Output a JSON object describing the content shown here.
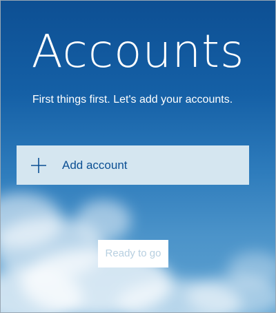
{
  "header": {
    "title": "Accounts",
    "subtitle": "First things first. Let's add your accounts."
  },
  "actions": {
    "add_account_label": "Add account",
    "ready_label": "Ready to go",
    "ready_state": "disabled"
  },
  "icons": {
    "add": "plus-icon"
  },
  "colors": {
    "sky_top": "#0d4f93",
    "sky_bottom": "#5fa3d2",
    "add_button_bg": "#d5e6f0",
    "add_button_text": "#0b4f93",
    "ready_button_bg": "#ffffff",
    "ready_button_text": "#b7cfe0"
  }
}
